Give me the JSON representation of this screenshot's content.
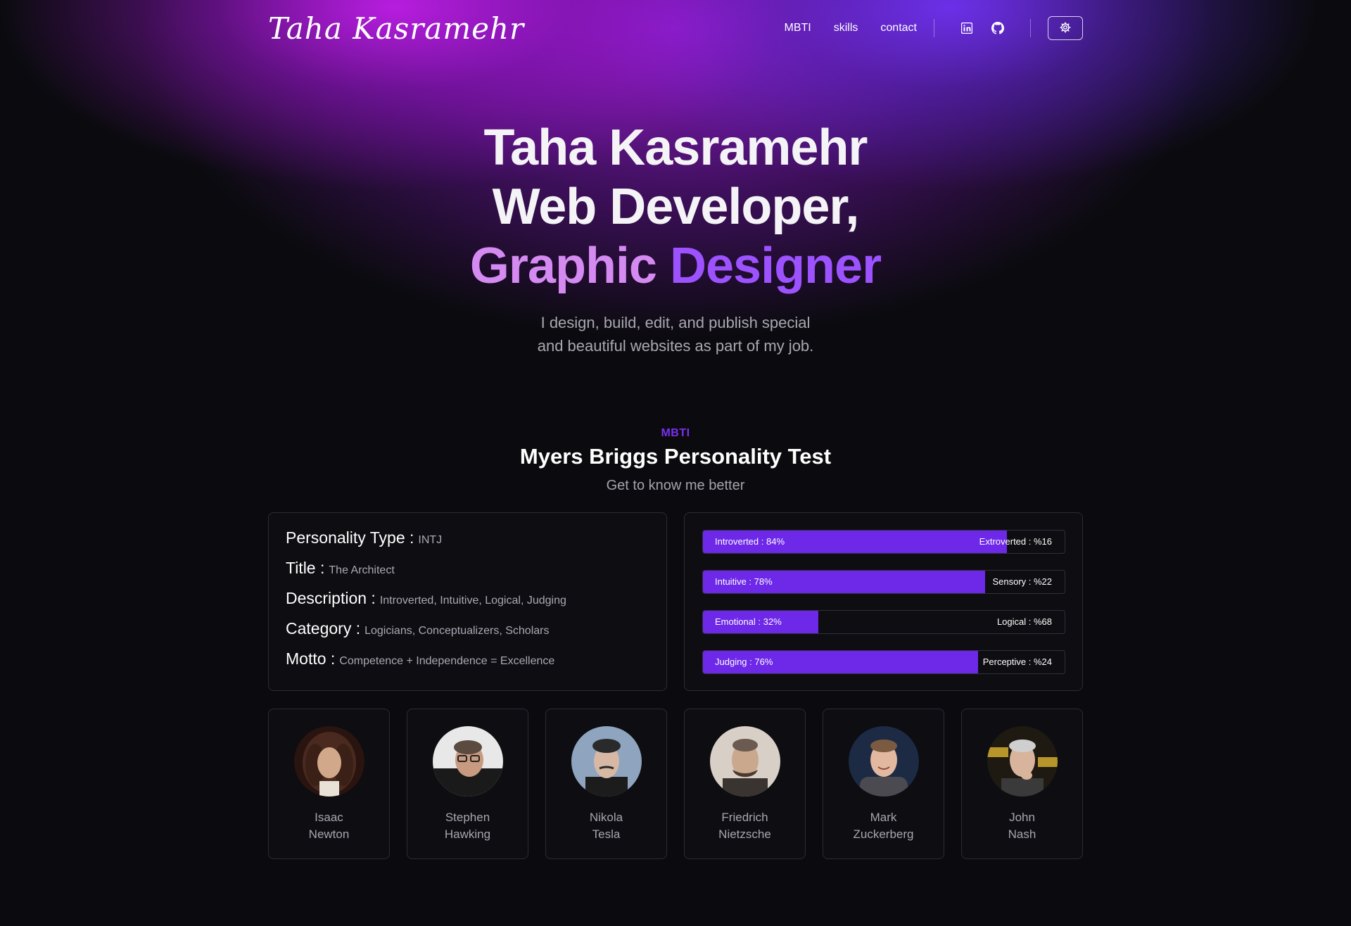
{
  "nav": {
    "logo": "Taha Kasramehr",
    "links": [
      "MBTI",
      "skills",
      "contact"
    ],
    "icons": [
      "linkedin-icon",
      "github-icon"
    ],
    "settings_icon": "gear-icon"
  },
  "hero": {
    "line1": "Taha Kasramehr",
    "line2": "Web Developer,",
    "line3_word1": "Graphic",
    "line3_word2": "Designer",
    "sub1": "I design, build, edit, and publish special",
    "sub2": "and beautiful websites as part of my job."
  },
  "mbti": {
    "tag": "MBTI",
    "title": "Myers Briggs Personality Test",
    "subtitle": "Get to know me better",
    "info": [
      {
        "key": "Personality Type :",
        "value": "INTJ"
      },
      {
        "key": "Title :",
        "value": "The Architect"
      },
      {
        "key": "Description :",
        "value": "Introverted, Intuitive, Logical, Judging"
      },
      {
        "key": "Category :",
        "value": "Logicians, Conceptualizers, Scholars"
      },
      {
        "key": "Motto :",
        "value": "Competence + Independence = Excellence"
      }
    ],
    "bars": [
      {
        "left": "Introverted : 84%",
        "right": "Extroverted : %16",
        "fill_percent": 84
      },
      {
        "left": "Intuitive : 78%",
        "right": "Sensory : %22",
        "fill_percent": 78
      },
      {
        "left": "Emotional : 32%",
        "right": "Logical : %68",
        "fill_percent": 32
      },
      {
        "left": "Judging : 76%",
        "right": "Perceptive : %24",
        "fill_percent": 76
      }
    ],
    "accent_color": "#6d28e8"
  },
  "people": [
    {
      "first": "Isaac",
      "last": "Newton"
    },
    {
      "first": "Stephen",
      "last": "Hawking"
    },
    {
      "first": "Nikola",
      "last": "Tesla"
    },
    {
      "first": "Friedrich",
      "last": "Nietzsche"
    },
    {
      "first": "Mark",
      "last": "Zuckerberg"
    },
    {
      "first": "John",
      "last": "Nash"
    }
  ]
}
